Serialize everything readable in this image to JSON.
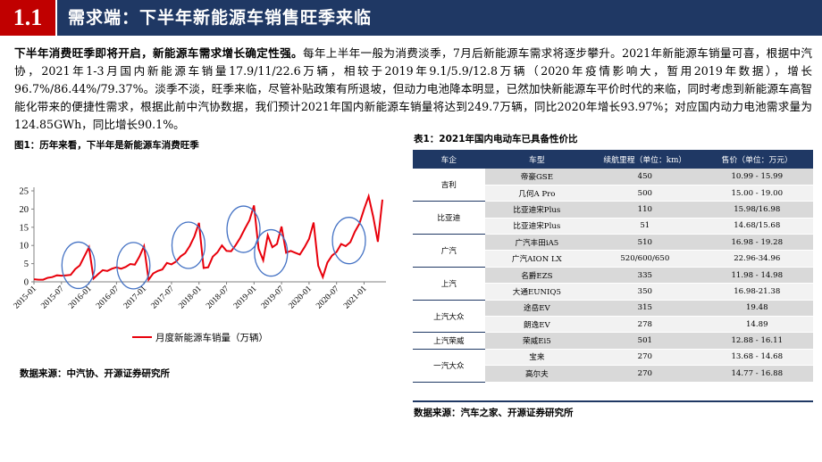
{
  "header": {
    "section_number": "1.1",
    "title": "需求端：下半年新能源车销售旺季来临"
  },
  "paragraph": {
    "lead": "下半年消费旺季即将开启，新能源车需求增长确定性强。",
    "body": "每年上半年一般为消费淡季，7月后新能源车需求将逐步攀升。2021年新能源车销量可喜，根据中汽协，2021年1-3月国内新能源车销量17.9/11/22.6万辆，相较于2019年9.1/5.9/12.8万辆（2020年疫情影响大，暂用2019年数据），增长96.7%/86.44%/79.37%。淡季不淡，旺季来临，尽管补贴政策有所退坡，但动力电池降本明显，已然加快新能源车平价时代的来临，同时考虑到新能源车高智能化带来的便捷性需求，根据此前中汽协数据，我们预计2021年国内新能源车销量将达到249.7万辆，同比2020年增长93.97%；对应国内动力电池需求量为124.85GWh，同比增长90.1%。"
  },
  "figure": {
    "title": "图1：历年来看，下半年是新能源车消费旺季",
    "source": "数据来源：中汽协、开源证券研究所"
  },
  "chart_data": {
    "type": "line",
    "title": "",
    "xlabel": "",
    "ylabel": "",
    "ylim": [
      0,
      25
    ],
    "yticks": [
      "0",
      "5",
      "10",
      "15",
      "20",
      "25"
    ],
    "xticks": [
      "2015-01",
      "2015-07",
      "2016-01",
      "2016-07",
      "2017-01",
      "2017-07",
      "2018-01",
      "2018-07",
      "2019-01",
      "2019-07",
      "2020-01",
      "2020-07",
      "2021-01"
    ],
    "x_start": "2015-01",
    "grid": false,
    "legend": "bottom",
    "series": [
      {
        "name": "月度新能源车销量（万辆）",
        "color": "#e8000b",
        "values": [
          0.7,
          0.6,
          0.6,
          1.1,
          1.3,
          1.8,
          1.7,
          1.8,
          1.9,
          3.5,
          4.5,
          7.0,
          9.5,
          0.9,
          2.1,
          3.2,
          3.0,
          3.6,
          4.0,
          3.6,
          4.1,
          4.9,
          4.7,
          6.9,
          9.8,
          0.6,
          2.3,
          3.0,
          3.4,
          5.2,
          4.8,
          5.6,
          7.0,
          7.9,
          9.9,
          12.5,
          16.2,
          3.8,
          4.0,
          6.9,
          8.1,
          10.0,
          8.5,
          8.4,
          10.1,
          12.1,
          14.6,
          16.9,
          21.0,
          9.1,
          5.9,
          12.8,
          9.5,
          10.4,
          15.2,
          8.0,
          8.5,
          8.0,
          7.5,
          9.5,
          11.8,
          16.3,
          4.4,
          1.3,
          5.3,
          7.2,
          8.2,
          10.4,
          9.8,
          10.9,
          13.8,
          16.0,
          20.0,
          23.5,
          17.9,
          11.0,
          22.6
        ]
      }
    ],
    "highlight_circles": [
      "2015-12",
      "2016-12",
      "2017-12",
      "2018-12",
      "2019-06",
      "2020-11"
    ]
  },
  "table": {
    "title": "表1：2021年国内电动车已具备性价比",
    "source": "数据来源：汽车之家、开源证券研究所",
    "headers": [
      "车企",
      "车型",
      "续航里程（单位：km）",
      "售价（单位：万元）"
    ],
    "rows": [
      {
        "brand": "吉利",
        "model": "帝豪GSE",
        "range": "450",
        "price": "10.99 - 15.99"
      },
      {
        "brand": "",
        "model": "几何A Pro",
        "range": "500",
        "price": "15.00 - 19.00"
      },
      {
        "brand": "比亚迪",
        "model": "比亚迪宋Plus",
        "range": "110",
        "price": "15.98/16.98"
      },
      {
        "brand": "",
        "model": "比亚迪宋Plus",
        "range": "51",
        "price": "14.68/15.68"
      },
      {
        "brand": "广汽",
        "model": "广汽丰田iA5",
        "range": "510",
        "price": "16.98 - 19.28"
      },
      {
        "brand": "",
        "model": "广汽AION LX",
        "range": "520/600/650",
        "price": "22.96-34.96"
      },
      {
        "brand": "上汽",
        "model": "名爵EZS",
        "range": "335",
        "price": "11.98 - 14.98"
      },
      {
        "brand": "",
        "model": "大通EUNIQ5",
        "range": "350",
        "price": "16.98-21.38"
      },
      {
        "brand": "上汽大众",
        "model": "途岳EV",
        "range": "315",
        "price": "19.48"
      },
      {
        "brand": "",
        "model": "朗逸EV",
        "range": "278",
        "price": "14.89"
      },
      {
        "brand": "上汽荣威",
        "model": "荣威Ei5",
        "range": "501",
        "price": "12.88 - 16.11"
      },
      {
        "brand": "一汽大众",
        "model": "宝来",
        "range": "270",
        "price": "13.68 - 14.68"
      },
      {
        "brand": "",
        "model": "高尔夫",
        "range": "270",
        "price": "14.77 - 16.88"
      }
    ]
  }
}
